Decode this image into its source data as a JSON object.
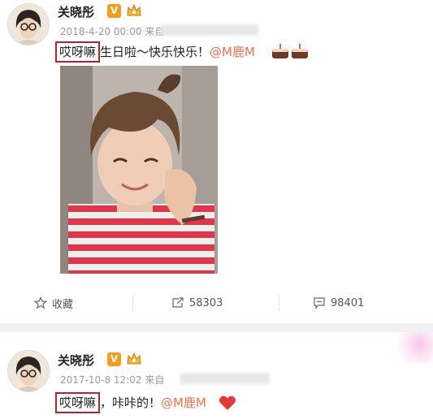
{
  "posts": [
    {
      "author": "关晓彤",
      "verified_badge": "V",
      "time": "2018-4-20 00:00",
      "source_prefix": "来自",
      "highlighted": "哎呀嘛",
      "text": "生日啦～快乐快乐！",
      "mention": "@M鹿M",
      "emoji": "cake-icon cake-icon",
      "actions": {
        "favorite_label": "收藏",
        "repost_count": "58303",
        "comment_count": "98401"
      }
    },
    {
      "author": "关晓彤",
      "verified_badge": "V",
      "time": "2017-10-8 12:02",
      "source_prefix": "来自",
      "highlighted": "哎呀嘛",
      "text": "，咔咔的！",
      "mention": "@M鹿M",
      "emoji": "heart-icon"
    }
  ],
  "colors": {
    "highlight_box": "#b3262e",
    "mention": "#eb7350",
    "badge": "#f39c1e",
    "heart": "#e8373a"
  }
}
